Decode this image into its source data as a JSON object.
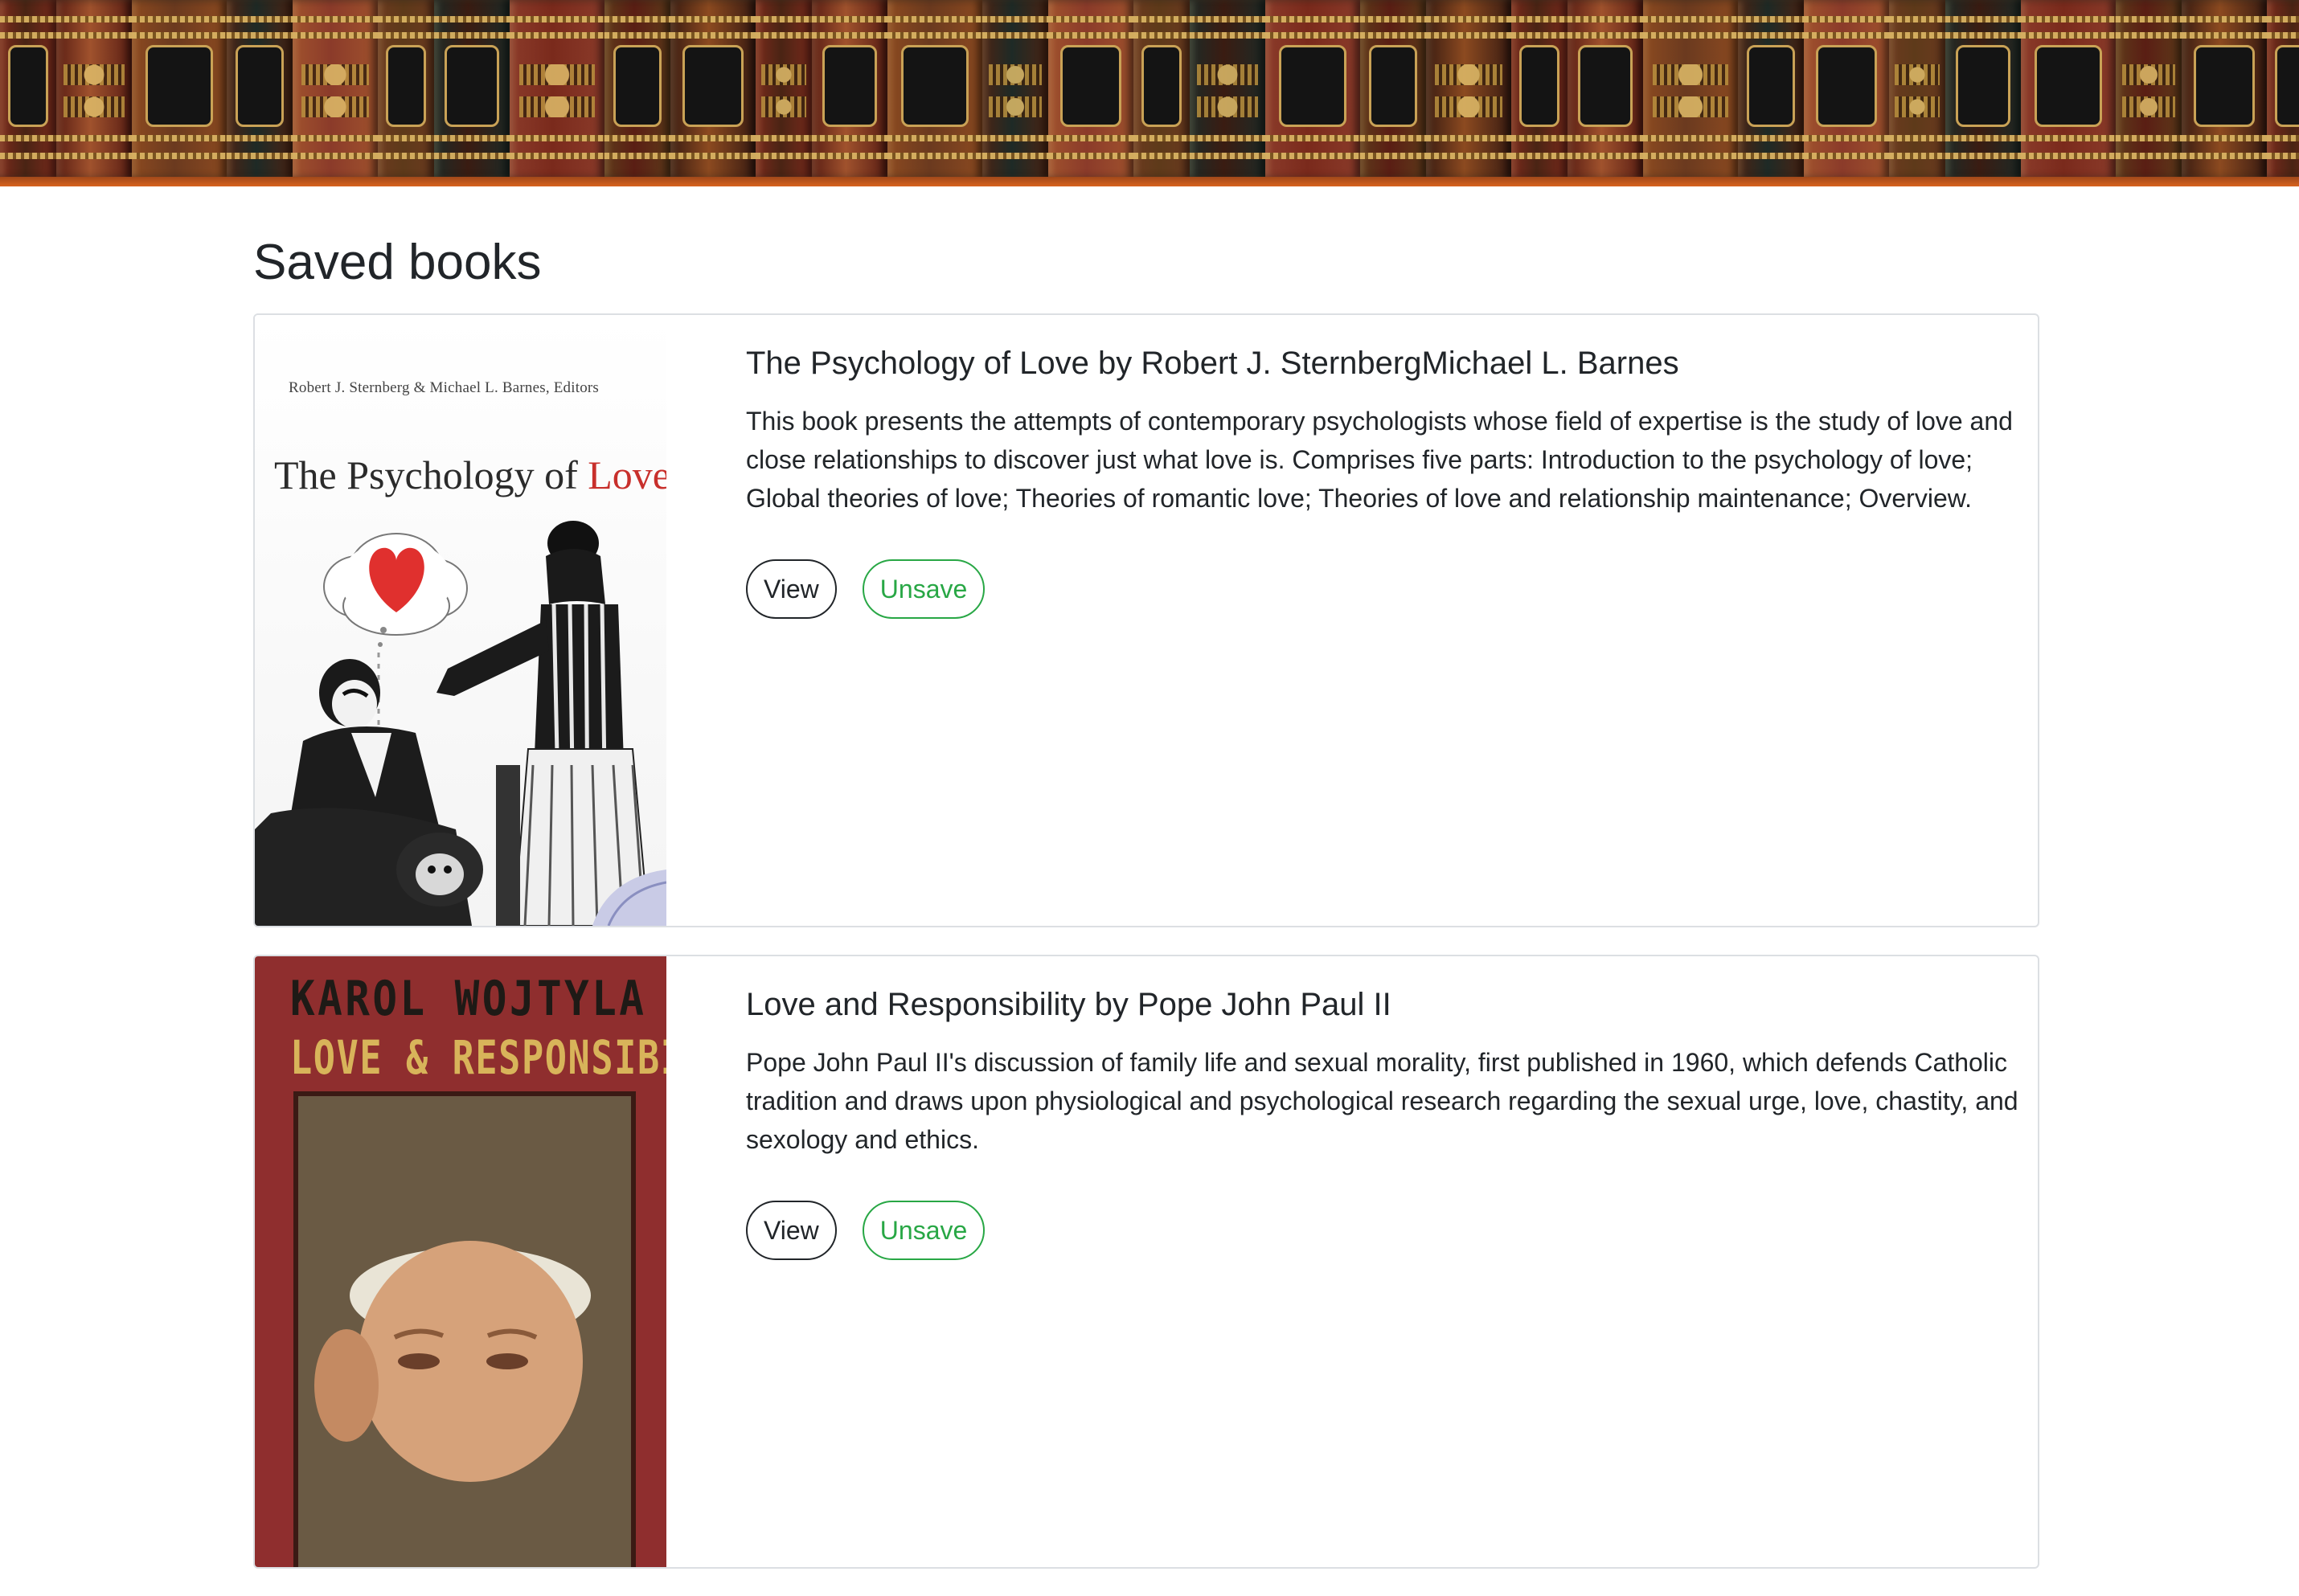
{
  "page": {
    "title": "Saved books"
  },
  "books": [
    {
      "title": "The Psychology of Love by Robert J. SternbergMichael L. Barnes",
      "description": "This book presents the attempts of contemporary psychologists whose field of expertise is the study of love and close relationships to discover just what love is. Comprises five parts: Introduction to the psychology of love; Global theories of love; Theories of romantic love; Theories of love and relationship maintenance; Overview.",
      "view_label": "View",
      "unsave_label": "Unsave",
      "cover": {
        "editors": "Robert J. Sternberg & Michael L. Barnes, Editors",
        "title_prefix": "The Psychology of ",
        "title_highlight": "Love"
      }
    },
    {
      "title": "Love and Responsibility by Pope John Paul II",
      "description": "Pope John Paul II's discussion of family life and sexual morality, first published in 1960, which defends Catholic tradition and draws upon physiological and psychological research regarding the sexual urge, love, chastity, and sexology and ethics.",
      "view_label": "View",
      "unsave_label": "Unsave",
      "cover": {
        "author": "KAROL WOJTYLA",
        "title": "LOVE & RESPONSIBILITY"
      }
    }
  ],
  "colors": {
    "text": "#212529",
    "card_border": "#dcdfe3",
    "unsave_green": "#28a745",
    "cover2_red": "#8f2e2e",
    "cover_heart_red": "#e0302e"
  },
  "icons": {
    "banner": "antique-bookshelf-banner"
  }
}
